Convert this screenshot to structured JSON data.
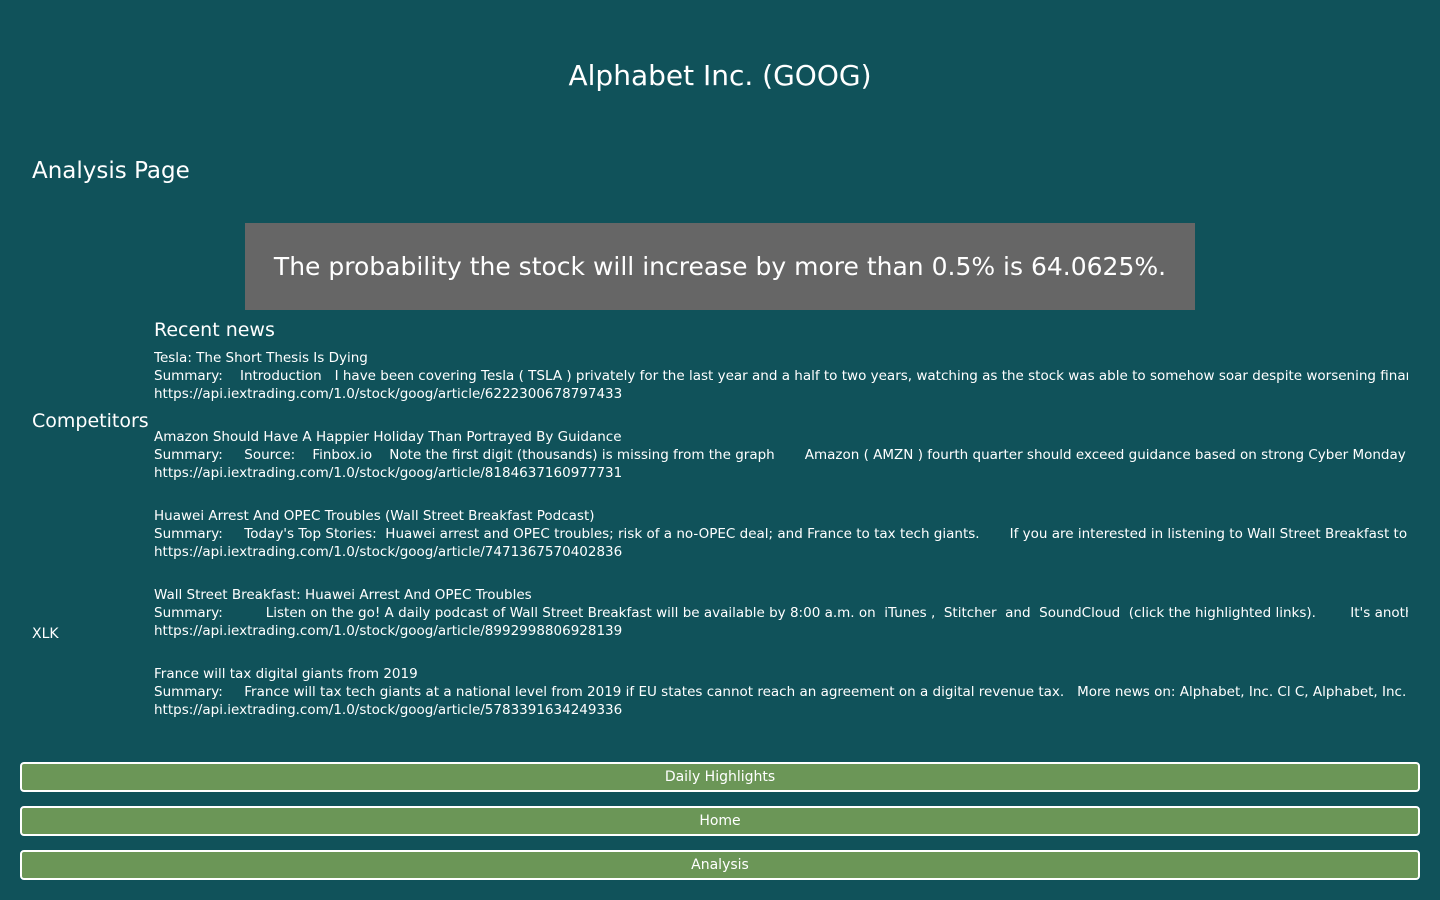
{
  "header": {
    "title": "Alphabet Inc. (GOOG)"
  },
  "analysis": {
    "heading": "Analysis Page",
    "probability_text": "The probability the stock will increase by more than 0.5% is 64.0625%."
  },
  "competitors": {
    "label": "Competitors",
    "items": [
      "XLK"
    ]
  },
  "news": {
    "heading": "Recent news",
    "items": [
      {
        "headline": "Tesla: The Short Thesis Is Dying",
        "summary": "Summary:    Introduction   I have been covering Tesla ( TSLA ) privately for the last year and a half to two years, watching as the stock was able to somehow soar despite worsening financia",
        "url": "https://api.iextrading.com/1.0/stock/goog/article/6222300678797433"
      },
      {
        "headline": "Amazon Should Have A Happier Holiday Than Portrayed By Guidance",
        "summary": "Summary:     Source:    Finbox.io    Note the first digit (thousands) is missing from the graph       Amazon ( AMZN ) fourth quarter should exceed guidance based on strong Cyber Monday sal",
        "url": "https://api.iextrading.com/1.0/stock/goog/article/8184637160977731"
      },
      {
        "headline": "Huawei Arrest And OPEC Troubles (Wall Street Breakfast Podcast)",
        "summary": "Summary:     Today's Top Stories:  Huawei arrest and OPEC troubles; risk of a no-OPEC deal; and France to tax tech giants.       If you are interested in listening to Wall Street Breakfast to st",
        "url": "https://api.iextrading.com/1.0/stock/goog/article/7471367570402836"
      },
      {
        "headline": "Wall Street Breakfast: Huawei Arrest And OPEC Troubles",
        "summary": "Summary:          Listen on the go! A daily podcast of Wall Street Breakfast will be available by 8:00 a.m. on  iTunes ,  Stitcher  and  SoundCloud  (click the highlighted links).        It's another",
        "url": "https://api.iextrading.com/1.0/stock/goog/article/8992998806928139"
      },
      {
        "headline": "France will tax digital giants from 2019",
        "summary": "Summary:     France will tax tech giants at a national level from 2019 if EU states cannot reach an agreement on a digital revenue tax.   More news on: Alphabet, Inc. Cl C, Alphabet, Inc. Cl",
        "url": "https://api.iextrading.com/1.0/stock/goog/article/5783391634249336"
      }
    ]
  },
  "nav": {
    "buttons": [
      "Daily Highlights",
      "Home",
      "Analysis"
    ]
  },
  "colors": {
    "background": "#10525a",
    "probability_box": "#666666",
    "button": "#6b9657",
    "text": "#ffffff"
  }
}
